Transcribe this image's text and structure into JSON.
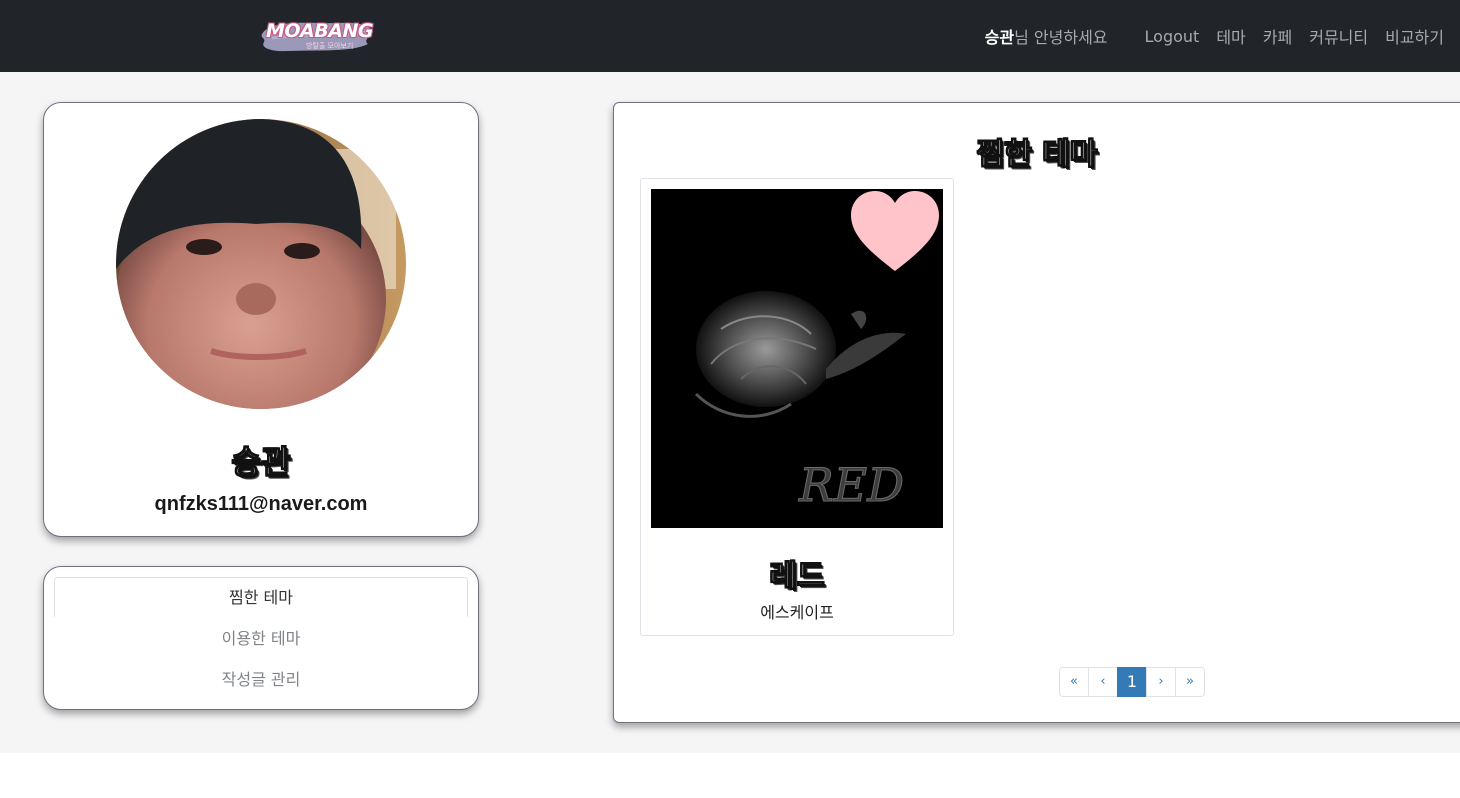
{
  "navbar": {
    "logo_text": "MOABANG",
    "logo_sub": "방탈출 모아보기",
    "greeting_name": "승관",
    "greeting_suffix": "님 안녕하세요",
    "links": [
      "Logout",
      "테마",
      "카페",
      "커뮤니티",
      "비교하기"
    ]
  },
  "profile": {
    "name": "승관",
    "email": "qnfzks111@naver.com"
  },
  "menu": {
    "items": [
      "찜한 테마",
      "이용한 테마",
      "작성글 관리"
    ],
    "active": "찜한 테마"
  },
  "main": {
    "title": "찜한 테마",
    "themes": [
      {
        "name": "레드",
        "category": "에스케이프",
        "image_text": "RED",
        "liked": true
      }
    ]
  },
  "pagination": {
    "first": "«",
    "prev": "‹",
    "current": "1",
    "next": "›",
    "last": "»"
  },
  "colors": {
    "navbar_bg": "#212529",
    "heart": "#ffc4c9",
    "page_active": "#337ab7"
  }
}
